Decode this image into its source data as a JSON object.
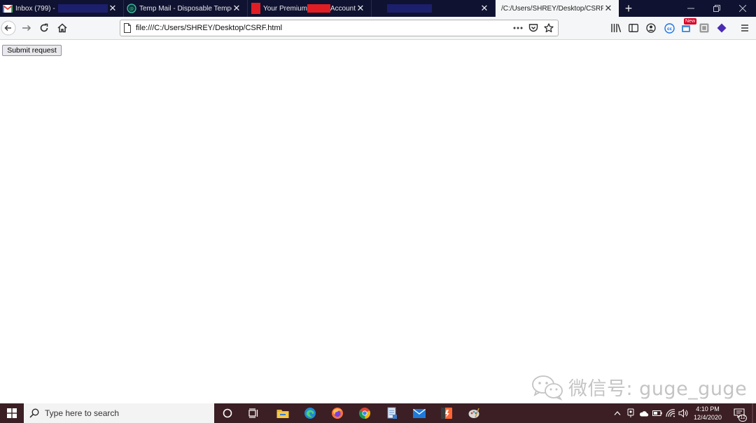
{
  "browser": {
    "tabs": [
      {
        "title": "Inbox (799) -",
        "favicon": "gmail-icon",
        "active": false
      },
      {
        "title": "Temp Mail - Disposable Tempo",
        "favicon": "tempmail-icon",
        "active": false
      },
      {
        "title_prefix": "Your Premium",
        "title_suffix": "Account",
        "favicon": "red-square-icon",
        "active": false
      },
      {
        "title": "",
        "favicon": "",
        "active": false
      },
      {
        "title": "/C:/Users/SHREY/Desktop/CSRF.ht",
        "favicon": "",
        "active": true
      }
    ],
    "new_tab_label": "+",
    "url": "file:///C:/Users/SHREY/Desktop/CSRF.html",
    "toolbar_icons": [
      "library-icon",
      "sidebar-icon",
      "account-icon",
      "cc-extension-icon",
      "new-extension-icon",
      "reader-extension-icon",
      "purple-extension-icon",
      "menu-icon"
    ],
    "new_badge": "New"
  },
  "page": {
    "submit_label": "Submit request"
  },
  "watermark": {
    "text": "微信号: guge_guge"
  },
  "taskbar": {
    "search_placeholder": "Type here to search",
    "clock_time": "4:10 PM",
    "clock_date": "12/4/2020",
    "notification_count": "12"
  },
  "colors": {
    "tabstrip_bg": "#0f1230",
    "taskbar_bg": "#3b1f24",
    "redact_navy": "#1c1f6b",
    "redact_red": "#e11d24"
  }
}
